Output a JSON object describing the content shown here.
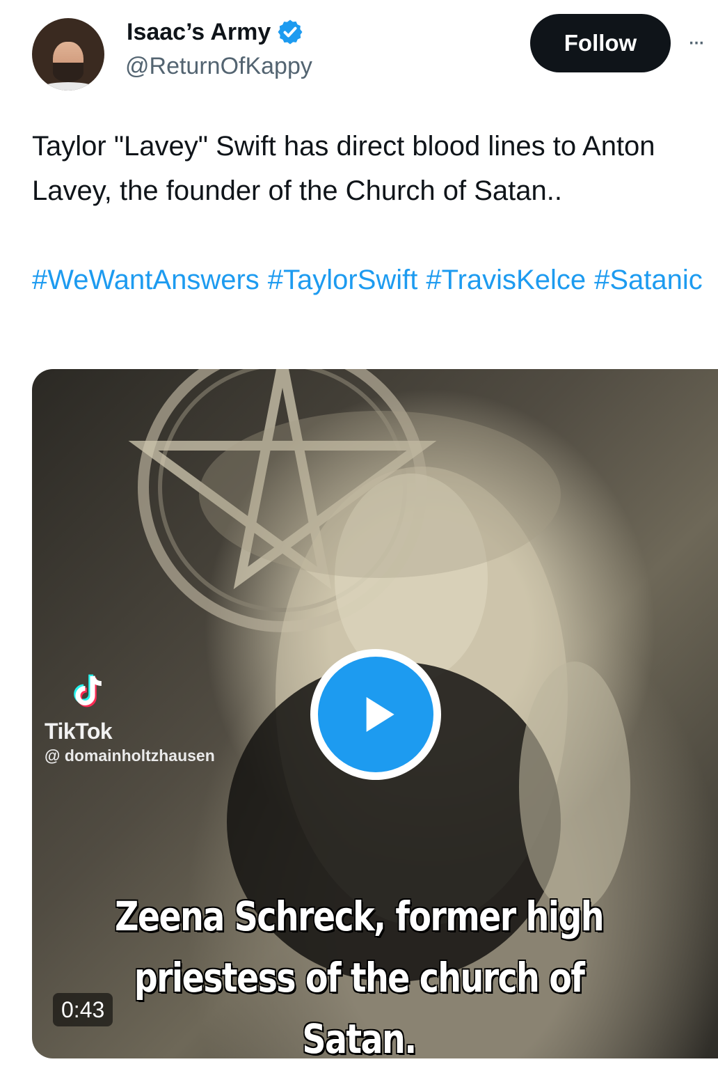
{
  "author": {
    "display_name": "Isaac’s Army",
    "handle": "@ReturnOfKappy",
    "verified_icon": "verified-badge-icon",
    "verified_color": "#1d9bf0"
  },
  "actions": {
    "follow_label": "Follow",
    "more_label": "···"
  },
  "tweet": {
    "text": "Taylor \"Lavey\" Swift has direct blood lines to Anton Lavey, the founder of the Church of Satan..",
    "hashtags": [
      "#WeWantAnswers",
      "#TaylorSwift",
      "#TravisKelce",
      "#Satanic"
    ],
    "hashtag_color": "#1d9bf0"
  },
  "media": {
    "type": "video",
    "watermark_brand": "TikTok",
    "watermark_user": "@ domainholtzhausen",
    "caption": "Zeena Schreck, former high priestess of the church of Satan.",
    "duration": "0:43",
    "play_button_color": "#1d9bf0"
  }
}
